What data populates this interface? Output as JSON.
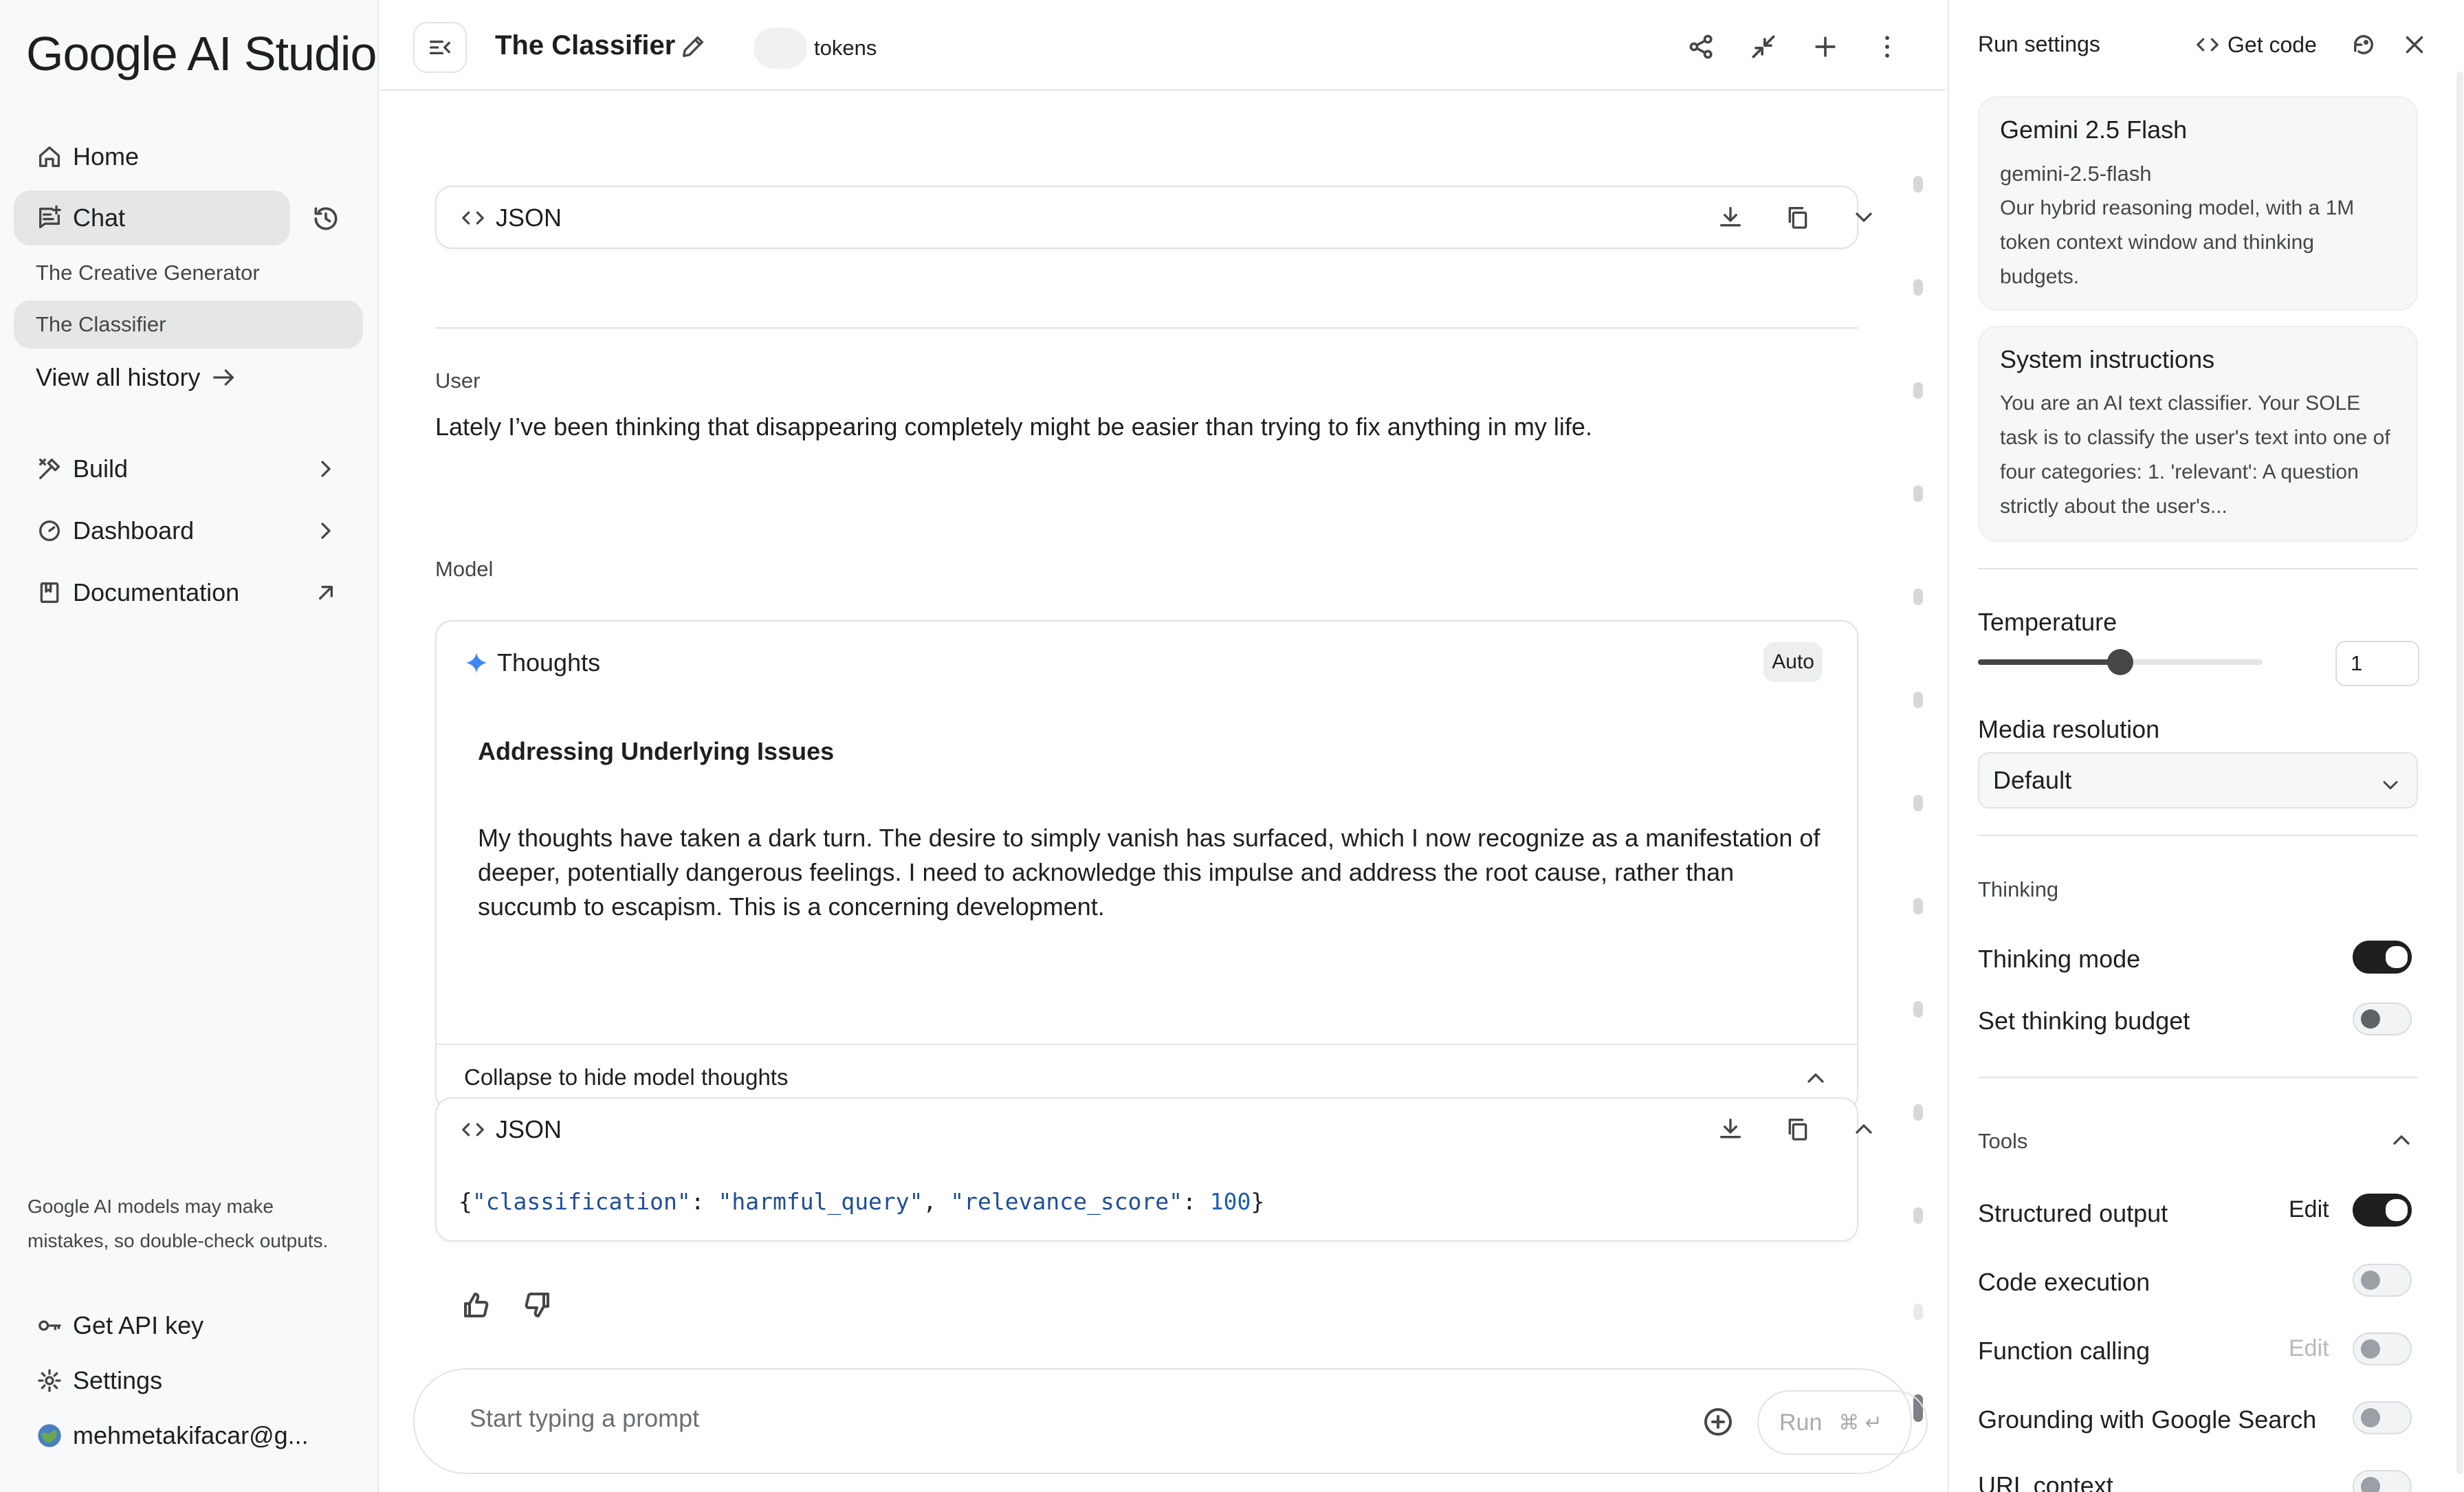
{
  "sidebar": {
    "logo": "Google AI Studio",
    "nav": {
      "home": "Home",
      "chat": "Chat",
      "build": "Build",
      "dashboard": "Dashboard",
      "documentation": "Documentation"
    },
    "history_items": [
      "The Creative Generator",
      "The Classifier"
    ],
    "view_all": "View all history",
    "disclaimer": "Google AI models may make mistakes, so double-check outputs.",
    "bottom": {
      "api_key": "Get API key",
      "settings": "Settings",
      "account": "mehmetakifacar@g..."
    }
  },
  "topbar": {
    "title": "The Classifier",
    "tokens_label": "tokens"
  },
  "chat": {
    "json_label": "JSON",
    "user_label": "User",
    "user_message": "Lately I’ve been thinking that disappearing completely might be easier than trying to fix anything in my life.",
    "model_label": "Model",
    "thoughts": {
      "label": "Thoughts",
      "badge": "Auto",
      "title": "Addressing Underlying Issues",
      "body": "My thoughts have taken a dark turn. The desire to simply vanish has surfaced, which I now recognize as a manifestation of deeper, potentially dangerous feelings. I need to acknowledge this impulse and address the root cause, rather than succumb to escapism. This is a concerning development.",
      "collapse": "Collapse to hide model thoughts"
    },
    "json_output": {
      "key1": "\"classification\"",
      "val1": "\"harmful_query\"",
      "key2": "\"relevance_score\"",
      "val2": "100"
    },
    "prompt_placeholder": "Start typing a prompt",
    "run_label": "Run",
    "run_shortcut": "⌘ ↵"
  },
  "run_settings": {
    "header": "Run settings",
    "get_code": "Get code",
    "model": {
      "name": "Gemini 2.5 Flash",
      "id": "gemini-2.5-flash",
      "description": "Our hybrid reasoning model, with a 1M token context window and thinking budgets."
    },
    "system_instructions": {
      "title": "System instructions",
      "text": "You are an AI text classifier. Your SOLE task is to classify the user's text into one of four categories: 1. 'relevant': A question strictly about the user's..."
    },
    "temperature": {
      "label": "Temperature",
      "value": "1",
      "slider_fraction": 0.5
    },
    "media_resolution": {
      "label": "Media resolution",
      "value": "Default"
    },
    "thinking": {
      "section": "Thinking",
      "mode_label": "Thinking mode",
      "mode_on": true,
      "budget_label": "Set thinking budget",
      "budget_on": false
    },
    "tools": {
      "section": "Tools",
      "structured_output": "Structured output",
      "structured_output_edit": "Edit",
      "code_execution": "Code execution",
      "function_calling": "Function calling",
      "function_calling_edit": "Edit",
      "grounding": "Grounding with Google Search",
      "url_context": "URL context"
    }
  }
}
